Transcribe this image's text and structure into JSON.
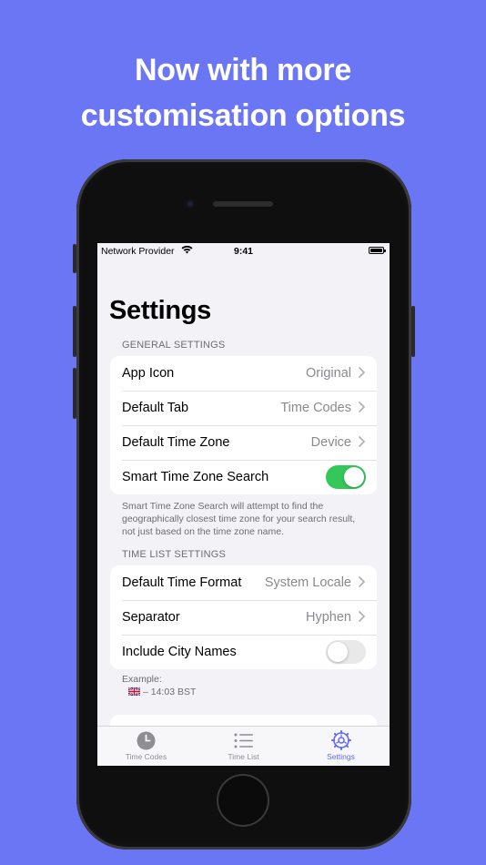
{
  "promo": {
    "line1": "Now with more",
    "line2": "customisation options"
  },
  "status_bar": {
    "carrier": "Network Provider",
    "time": "9:41"
  },
  "screen": {
    "title": "Settings",
    "general": {
      "header": "GENERAL SETTINGS",
      "rows": [
        {
          "label": "App Icon",
          "value": "Original"
        },
        {
          "label": "Default Tab",
          "value": "Time Codes"
        },
        {
          "label": "Default Time Zone",
          "value": "Device"
        },
        {
          "label": "Smart Time Zone Search",
          "toggle": true
        }
      ],
      "footer": "Smart Time Zone Search will attempt to find the geographically closest time zone for your search result, not just based on the time zone name."
    },
    "time_list": {
      "header": "TIME LIST SETTINGS",
      "rows": [
        {
          "label": "Default Time Format",
          "value": "System Locale"
        },
        {
          "label": "Separator",
          "value": "Hyphen"
        },
        {
          "label": "Include City Names",
          "toggle": false
        }
      ],
      "example_label": "Example:",
      "example_value": "– 14:03 BST"
    }
  },
  "tabbar": {
    "tabs": [
      {
        "label": "Time Codes",
        "icon": "clock-icon",
        "active": false
      },
      {
        "label": "Time List",
        "icon": "list-icon",
        "active": false
      },
      {
        "label": "Settings",
        "icon": "gear-icon",
        "active": true
      }
    ]
  },
  "colors": {
    "background": "#6b76f4",
    "accent": "#5f6bf0",
    "toggle_on": "#34c759"
  }
}
